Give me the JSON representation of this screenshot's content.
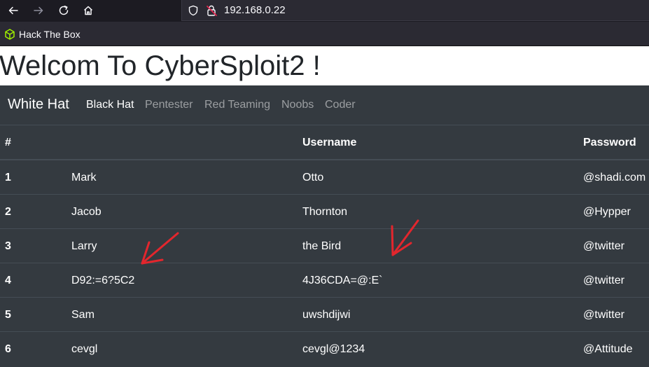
{
  "browser": {
    "url": "192.168.0.22",
    "bookmarks": [
      {
        "label": "Hack The Box"
      }
    ]
  },
  "page": {
    "title": "Welcom To CyberSploit2 !",
    "brand": "White Hat",
    "nav": [
      {
        "label": "Black Hat",
        "active": true
      },
      {
        "label": "Pentester"
      },
      {
        "label": "Red Teaming"
      },
      {
        "label": "Noobs"
      },
      {
        "label": "Coder"
      }
    ],
    "table": {
      "headers": [
        "#",
        "",
        "Username",
        "Password"
      ],
      "rows": [
        [
          "1",
          "Mark",
          "Otto",
          "@shadi.com"
        ],
        [
          "2",
          "Jacob",
          "Thornton",
          "@Hypper"
        ],
        [
          "3",
          "Larry",
          "the Bird",
          "@twitter"
        ],
        [
          "4",
          "D92:=6?5C2",
          "4J36CDA=@:E`",
          "@twitter"
        ],
        [
          "5",
          "Sam",
          "uwshdijwi",
          "@twitter"
        ],
        [
          "6",
          "cevgl",
          "cevgl@1234",
          "@Attitude"
        ]
      ]
    }
  },
  "colors": {
    "annotation_arrow": "#e3262d",
    "bookmark_icon": "#9fef00"
  }
}
